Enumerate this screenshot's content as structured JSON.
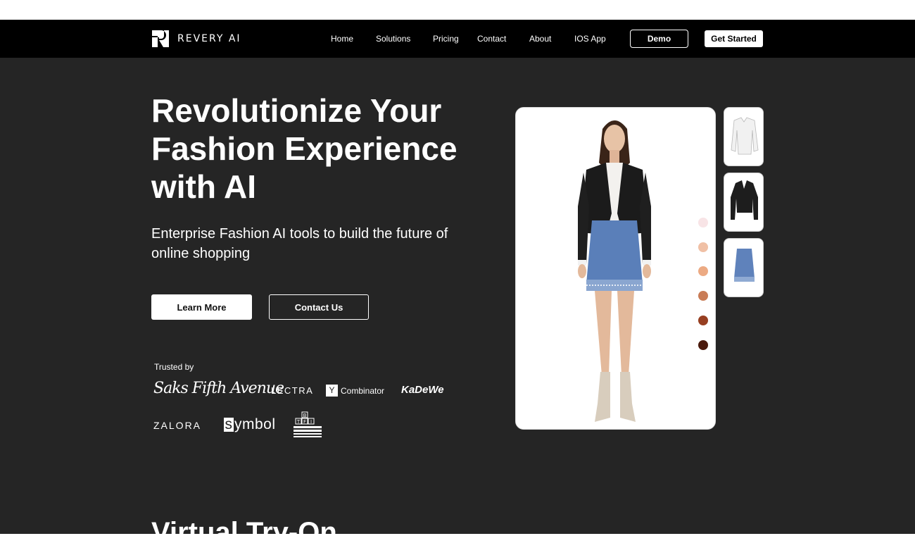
{
  "nav": {
    "brand": "REVERY AI",
    "links": [
      "Home",
      "Solutions",
      "Pricing",
      "Contact",
      "About",
      "IOS App"
    ],
    "demo_label": "Demo",
    "get_started_label": "Get Started"
  },
  "hero": {
    "title_lines": [
      "Revolutionize Your",
      "Fashion Experience",
      "with AI"
    ],
    "subtitle": "Enterprise Fashion AI tools to build the future of online shopping",
    "learn_more_label": "Learn More",
    "contact_us_label": "Contact Us"
  },
  "trusted": {
    "label": "Trusted by",
    "brands": {
      "saks": "Saks Fifth Avenue",
      "lectra": "LECTRA",
      "yc_mark": "Y",
      "yc": "Combinator",
      "kadewe": "KaDeWe",
      "zalora": "ZALORA",
      "symbol_s": "s",
      "symbol": "ymbol",
      "tfi": "THE BRIDGE FASHION INCUBATOR"
    }
  },
  "tryon": {
    "skin_tones": [
      "#f8e4e6",
      "#f0c0a5",
      "#ecaa83",
      "#c97c56",
      "#973f21",
      "#4a1a0c"
    ],
    "thumbnails": [
      "white-corset-top",
      "black-leather-jacket",
      "blue-tweed-skirt"
    ]
  },
  "next_section": {
    "title": "Virtual Try-On"
  },
  "colors": {
    "nav_bg": "#000000",
    "page_bg": "#252525",
    "text": "#ffffff"
  }
}
